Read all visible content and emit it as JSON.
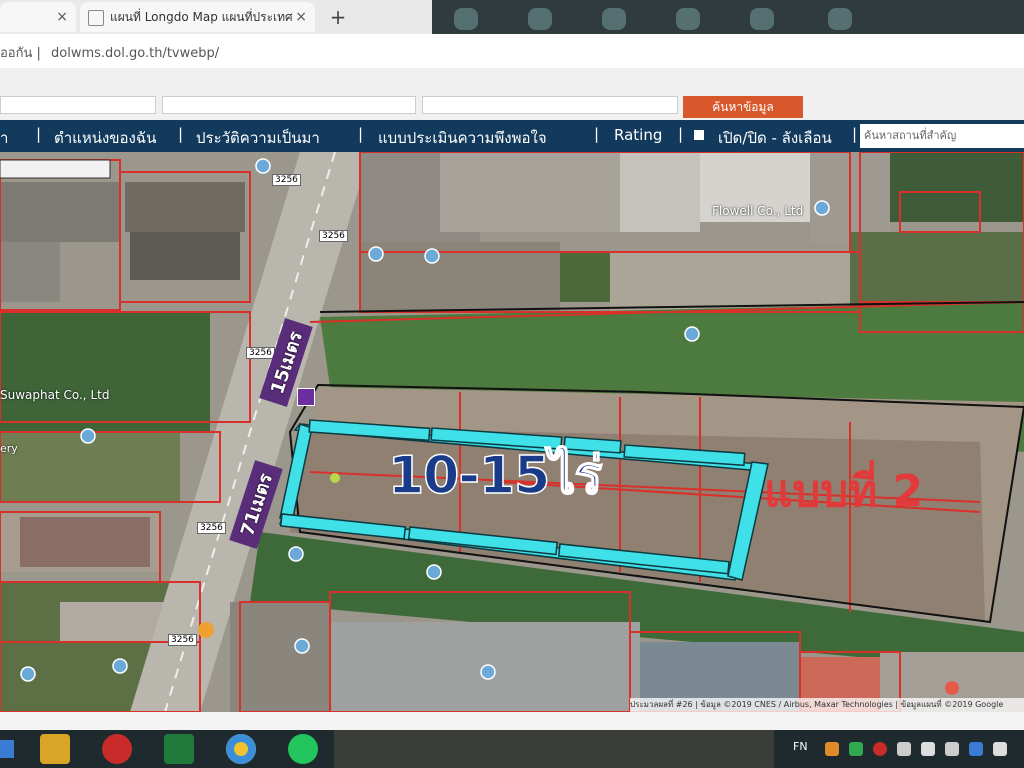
{
  "browser": {
    "tabs": [
      {
        "label": ""
      },
      {
        "label": "แผนที่ Longdo Map แผนที่ประเทศ"
      }
    ],
    "new_tab_symbol": "+",
    "close_symbol": "×",
    "url": "dolwms.dol.go.th/tvwebp/",
    "url_prefix": "ออกัน |"
  },
  "search_row": {
    "btn_label": "ค้นหาข้อมูล"
  },
  "nav": {
    "items": [
      {
        "label": "า"
      },
      {
        "label": "ตำแหน่งของฉัน"
      },
      {
        "label": "ประวัติความเป็นมา"
      },
      {
        "label": "แบบประเมินความพึงพอใจ"
      },
      {
        "label": "Rating"
      },
      {
        "label": "เปิด/ปิด - ลังเลือน"
      }
    ],
    "separator": "|",
    "search_placeholder": "ค้นหาสถานที่สำคัญ"
  },
  "map": {
    "labels": {
      "flowell": "Flowell Co., Ltd",
      "suwaphat": "Suwaphat Co., Ltd",
      "gallery": "ery",
      "road_top": "3256",
      "road_mid": "3256",
      "road_low": "3256",
      "road_low2": "3256",
      "road_bot": "3256",
      "dist_15": "15เมตร",
      "dist_71": "71เมตร",
      "area": "10-15ไร่",
      "model": "แบบที่ 2"
    },
    "colors": {
      "plot_outline": "#40e0e8",
      "cadastral": "#d9302a",
      "area_text": "#1a3a8a",
      "model_text": "#e23a3a",
      "distance_label_bg": "#5a2d7a"
    }
  },
  "attribution": "ประมวลผลที่ #26 | ข้อมูล ©2019 CNES / Airbus, Maxar Technologies | ข้อมูลแผนที่ ©2019 Google",
  "taskbar": {
    "lang": "FN"
  }
}
